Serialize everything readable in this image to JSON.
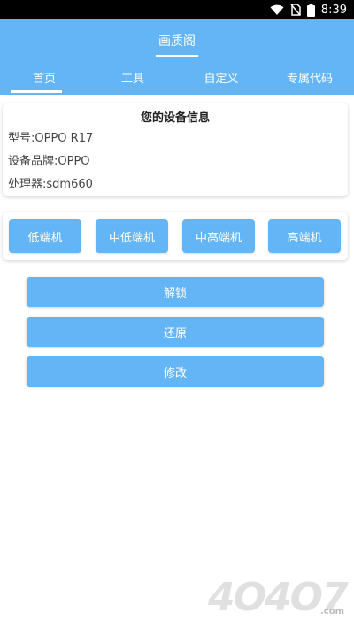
{
  "status_bar": {
    "time": "8:39"
  },
  "header": {
    "title": "画质阁",
    "tabs": [
      {
        "label": "首页",
        "active": true
      },
      {
        "label": "工具",
        "active": false
      },
      {
        "label": "自定义",
        "active": false
      },
      {
        "label": "专属代码",
        "active": false
      }
    ]
  },
  "device_info": {
    "title": "您的设备信息",
    "lines": [
      "型号:OPPO R17",
      "设备品牌:OPPO",
      "处理器:sdm660"
    ]
  },
  "tiers": [
    "低端机",
    "中低端机",
    "中高端机",
    "高端机"
  ],
  "actions": {
    "unlock": "解锁",
    "restore": "还原",
    "modify": "修改"
  },
  "watermark": {
    "text": "4O4O7",
    "suffix": ".com"
  },
  "colors": {
    "accent": "#64b5f6",
    "status_bar": "#000000"
  }
}
